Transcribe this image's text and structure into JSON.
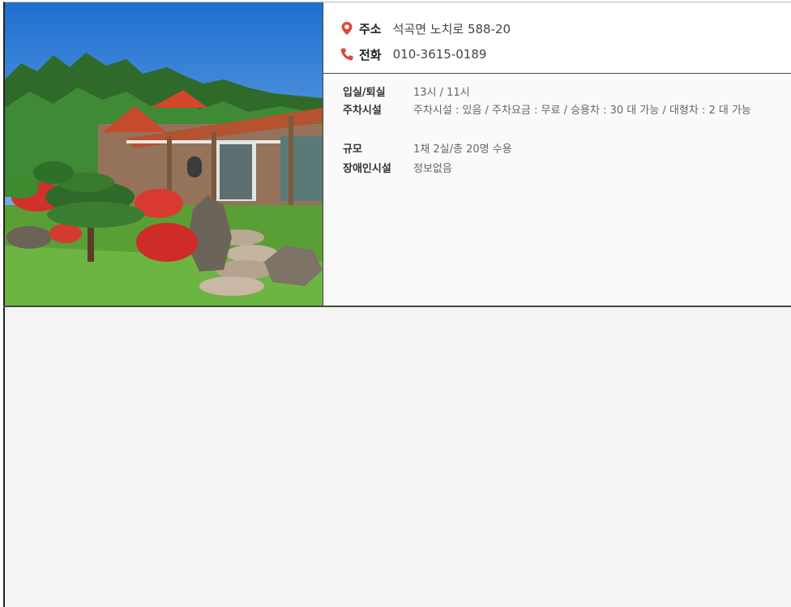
{
  "contact": {
    "address_label": "주소",
    "address_value": "석곡면 노치로 588-20",
    "phone_label": "전화",
    "phone_value": "010-3615-0189",
    "address_icon": "map-pin-icon",
    "phone_icon": "phone-icon",
    "icon_color": "#e0483a"
  },
  "details": [
    {
      "label": "입실/퇴실",
      "value": "13시 / 11시"
    },
    {
      "label": "주차시설",
      "value": "주차시설 : 있음 / 주차요금 : 무료 / 승용차 : 30 대 가능 / 대형차 : 2 대 가능"
    },
    {
      "label": "규모",
      "value": "1채 2실/총 20명 수용"
    },
    {
      "label": "장애인시설",
      "value": "정보없음"
    }
  ]
}
